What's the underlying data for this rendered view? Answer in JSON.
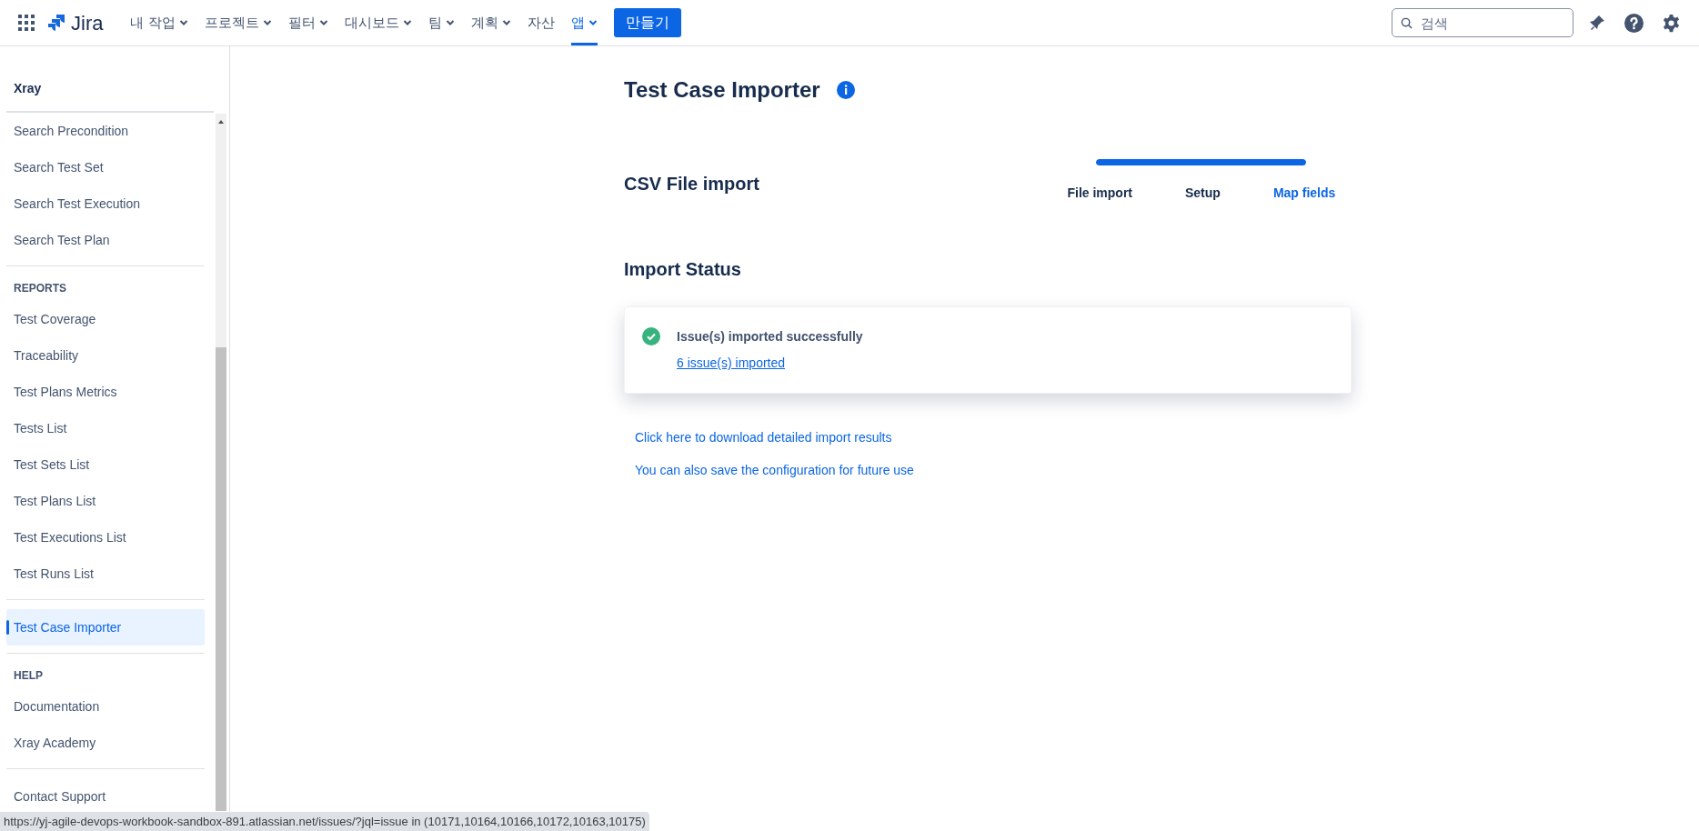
{
  "topbar": {
    "logo": "Jira",
    "nav": [
      {
        "label": "내 작업",
        "dropdown": true,
        "selected": false
      },
      {
        "label": "프로젝트",
        "dropdown": true,
        "selected": false
      },
      {
        "label": "필터",
        "dropdown": true,
        "selected": false
      },
      {
        "label": "대시보드",
        "dropdown": true,
        "selected": false
      },
      {
        "label": "팀",
        "dropdown": true,
        "selected": false
      },
      {
        "label": "계획",
        "dropdown": true,
        "selected": false
      },
      {
        "label": "자산",
        "dropdown": false,
        "selected": false
      },
      {
        "label": "앱",
        "dropdown": true,
        "selected": true
      }
    ],
    "create_button": "만들기",
    "search": {
      "placeholder": "검색"
    }
  },
  "sidebar": {
    "title": "Xray",
    "sections": [
      {
        "items": [
          {
            "label": "Search Precondition",
            "selected": false
          },
          {
            "label": "Search Test Set",
            "selected": false
          },
          {
            "label": "Search Test Execution",
            "selected": false
          },
          {
            "label": "Search Test Plan",
            "selected": false
          }
        ]
      },
      {
        "heading": "REPORTS",
        "items": [
          {
            "label": "Test Coverage",
            "selected": false
          },
          {
            "label": "Traceability",
            "selected": false
          },
          {
            "label": "Test Plans Metrics",
            "selected": false
          },
          {
            "label": "Tests List",
            "selected": false
          },
          {
            "label": "Test Sets List",
            "selected": false
          },
          {
            "label": "Test Plans List",
            "selected": false
          },
          {
            "label": "Test Executions List",
            "selected": false
          },
          {
            "label": "Test Runs List",
            "selected": false
          }
        ]
      },
      {
        "items": [
          {
            "label": "Test Case Importer",
            "selected": true
          }
        ]
      },
      {
        "heading": "HELP",
        "items": [
          {
            "label": "Documentation",
            "selected": false
          },
          {
            "label": "Xray Academy",
            "selected": false
          }
        ]
      },
      {
        "items": [
          {
            "label": "Contact Support",
            "selected": false
          }
        ]
      }
    ]
  },
  "main": {
    "title": "Test Case Importer",
    "subtitle": "CSV File import",
    "progress": {
      "level": 1
    },
    "steps": [
      {
        "label": "File import",
        "selected": false
      },
      {
        "label": "Setup",
        "selected": false
      },
      {
        "label": "Map fields",
        "selected": true
      }
    ],
    "status_heading": "Import Status",
    "status_card": {
      "message": "Issue(s) imported successfully",
      "link": "6 issue(s) imported"
    },
    "links": [
      "Click here to download detailed import results",
      "You can also save the configuration for future use"
    ]
  },
  "status_bar": "https://yj-agile-devops-workbook-sandbox-891.atlassian.net/issues/?jql=issue in (10171,10164,10166,10172,10163,10175)"
}
